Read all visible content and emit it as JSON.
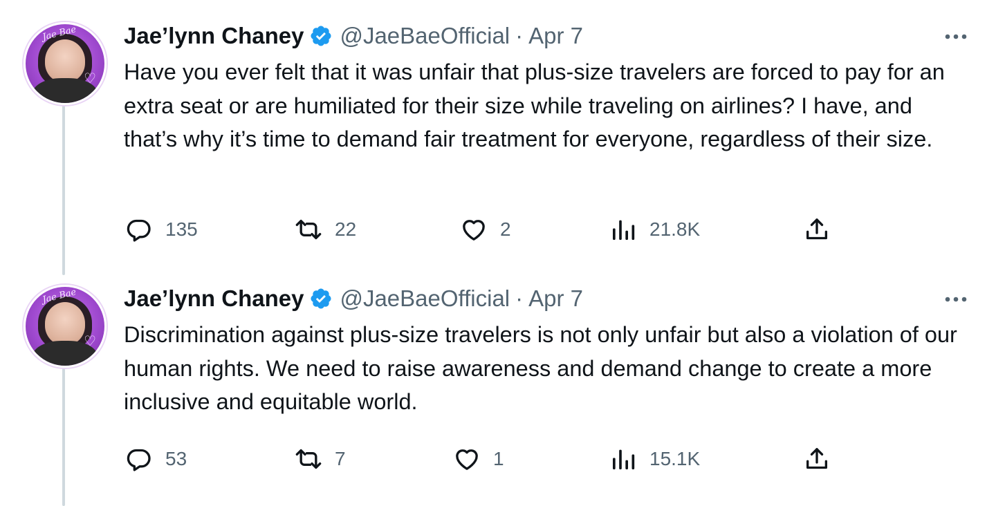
{
  "tweets": [
    {
      "author": {
        "name": "Jae’lynn Chaney",
        "handle": "@JaeBaeOfficial",
        "verified": true,
        "avatar_text": "Jae Bae"
      },
      "dot": "·",
      "date": "Apr 7",
      "text": "Have you ever felt that it was unfair that plus-size travelers are forced to pay for an extra seat or are humiliated for their size while traveling on airlines? I have, and that’s why it’s time to demand fair treatment for everyone, regardless of their size.",
      "stats": {
        "replies": "135",
        "retweets": "22",
        "likes": "2",
        "views": "21.8K"
      }
    },
    {
      "author": {
        "name": "Jae’lynn Chaney",
        "handle": "@JaeBaeOfficial",
        "verified": true,
        "avatar_text": "Jae Bae"
      },
      "dot": "·",
      "date": "Apr 7",
      "text": "Discrimination against plus-size travelers is not only unfair but also a violation of our human rights. We need to raise awareness and demand change to create a more inclusive and equitable world.",
      "stats": {
        "replies": "53",
        "retweets": "7",
        "likes": "1",
        "views": "15.1K"
      }
    }
  ],
  "colors": {
    "verified": "#1d9bf0",
    "secondary_text": "#536471",
    "thread_line": "#cfd9de"
  },
  "icons": [
    "verified-badge-icon",
    "more-icon",
    "reply-icon",
    "retweet-icon",
    "like-icon",
    "views-icon",
    "share-icon"
  ]
}
